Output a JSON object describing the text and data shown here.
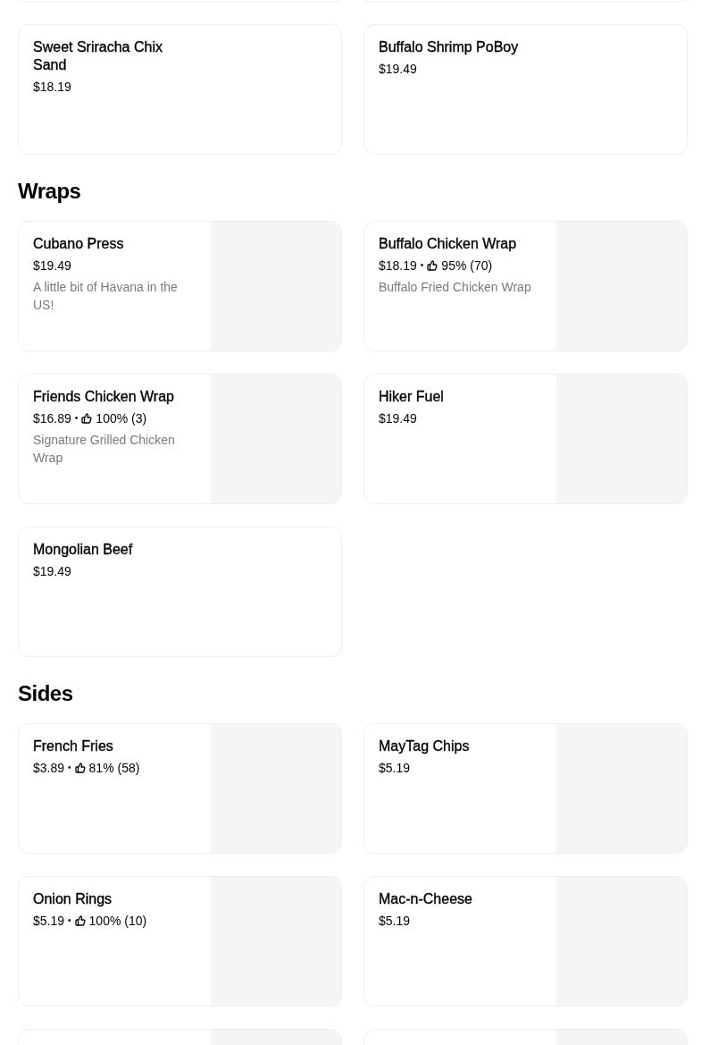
{
  "sections": [
    {
      "items": [
        {
          "kind": "text_only"
        },
        {
          "kind": "text_only"
        }
      ]
    },
    {
      "items": [
        {
          "kind": "text_only",
          "name": "Sweet Sriracha Chix Sand",
          "price": "$18.19"
        },
        {
          "kind": "text_only",
          "name": "Buffalo Shrimp PoBoy",
          "price": "$19.49"
        }
      ]
    },
    {
      "title": "Wraps",
      "items": [
        {
          "kind": "with_image",
          "name": "Cubano Press",
          "price": "$19.49",
          "description": "A little bit of Havana in the US!"
        },
        {
          "kind": "with_image",
          "name": "Buffalo Chicken Wrap",
          "price": "$18.19",
          "separator": "•",
          "rating": "95% (70)",
          "description": "Buffalo Fried Chicken Wrap"
        },
        {
          "kind": "with_image",
          "name": "Friends Chicken Wrap",
          "price": "$16.89",
          "separator": "•",
          "rating": "100% (3)",
          "description": "Signature Grilled Chicken Wrap"
        },
        {
          "kind": "with_image",
          "name": "Hiker Fuel",
          "price": "$19.49"
        },
        {
          "kind": "text_only",
          "name": "Mongolian Beef",
          "price": "$19.49"
        }
      ]
    },
    {
      "title": "Sides",
      "items": [
        {
          "kind": "with_image",
          "name": "French Fries",
          "price": "$3.89",
          "separator": "•",
          "rating": "81% (58)"
        },
        {
          "kind": "with_image",
          "name": "MayTag Chips",
          "price": "$5.19"
        },
        {
          "kind": "with_image",
          "name": "Onion Rings",
          "price": "$5.19",
          "separator": "•",
          "rating": "100% (10)"
        },
        {
          "kind": "with_image",
          "name": "Mac-n-Cheese",
          "price": "$5.19"
        },
        {
          "kind": "with_image"
        },
        {
          "kind": "with_image"
        }
      ]
    }
  ]
}
